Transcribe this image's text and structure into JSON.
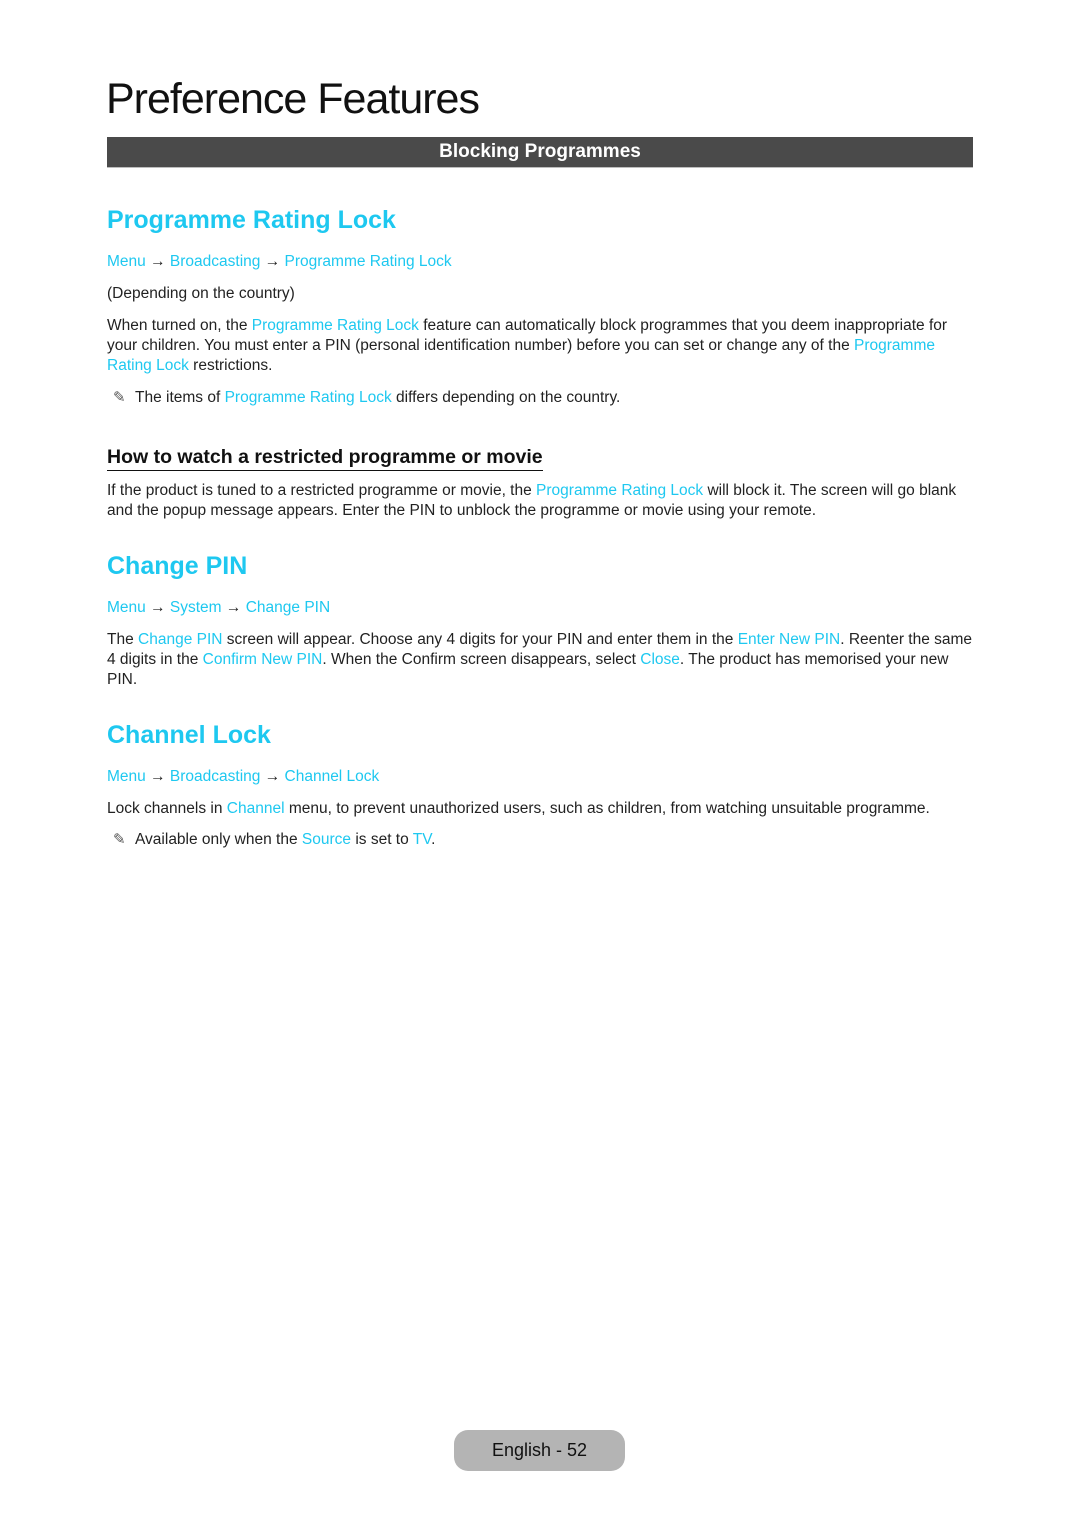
{
  "page_title": "Preference Features",
  "section_bar": "Blocking Programmes",
  "accent_color": "#1ec8f0",
  "sections": {
    "rating_lock": {
      "heading": "Programme Rating Lock",
      "path": [
        "Menu",
        "Broadcasting",
        "Programme Rating Lock"
      ],
      "availability": "(Depending on the country)",
      "para": {
        "t1": "When turned on, the ",
        "h1": "Programme Rating Lock",
        "t2": " feature can automatically block programmes that you deem inappropriate for your children. You must enter a PIN (personal identification number) before you can set or change any of the ",
        "h2": "Programme Rating Lock",
        "t3": " restrictions."
      },
      "note": {
        "icon": "note-pencil-icon",
        "t1": "The items of ",
        "h1": "Programme Rating Lock",
        "t2": " differs depending on the country."
      },
      "subheading": "How to watch a restricted programme or movie",
      "sub_para": {
        "t1": "If the product is tuned to a restricted programme or movie, the ",
        "h1": "Programme Rating Lock",
        "t2": " will block it. The screen will go blank and the popup message appears. Enter the PIN to unblock the programme or movie using your remote."
      }
    },
    "change_pin": {
      "heading": "Change PIN",
      "path": [
        "Menu",
        "System",
        "Change PIN"
      ],
      "para": {
        "t1": "The ",
        "h1": "Change PIN",
        "t2": " screen will appear. Choose any 4 digits for your PIN and enter them in the ",
        "h2": "Enter New PIN",
        "t3": ". Reenter the same 4 digits in the ",
        "h3": "Confirm New PIN",
        "t4": ". When the Confirm screen disappears, select ",
        "h4": "Close",
        "t5": ". The product has memorised your new PIN."
      }
    },
    "channel_lock": {
      "heading": "Channel Lock",
      "path": [
        "Menu",
        "Broadcasting",
        "Channel Lock"
      ],
      "para": {
        "t1": "Lock channels in ",
        "h1": "Channel",
        "t2": " menu, to prevent unauthorized users, such as children, from watching unsuitable programme."
      },
      "note": {
        "icon": "note-pencil-icon",
        "t1": "Available only when the ",
        "h1": "Source",
        "t2": " is set to ",
        "h2": "TV",
        "t3": "."
      }
    }
  },
  "arrow": "→",
  "note_glyph": "✎",
  "footer": {
    "page_label": "English - 52"
  }
}
